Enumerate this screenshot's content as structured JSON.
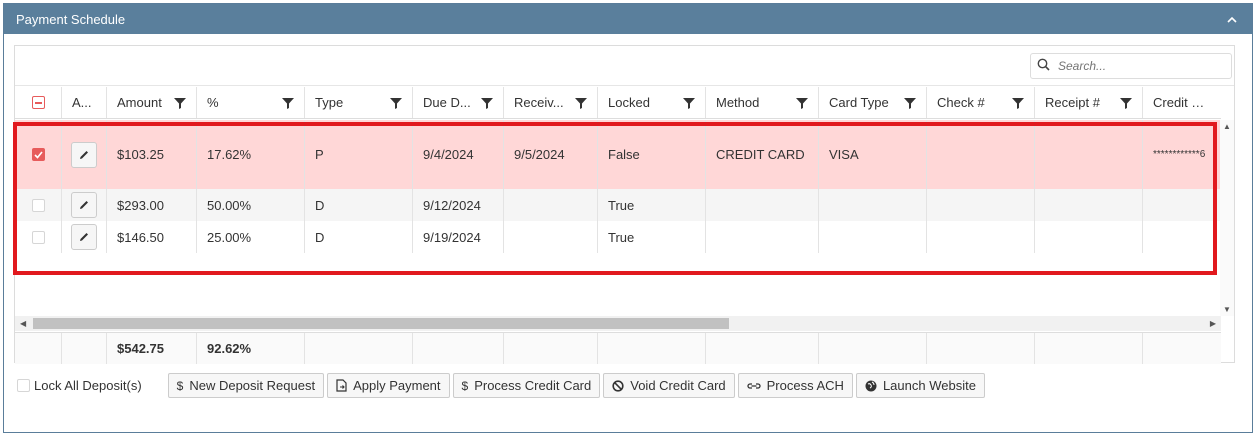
{
  "panel": {
    "title": "Payment Schedule"
  },
  "search": {
    "placeholder": "Search..."
  },
  "columns": [
    {
      "label": "",
      "filter": false
    },
    {
      "label": "A...",
      "filter": false
    },
    {
      "label": "Amount",
      "filter": true
    },
    {
      "label": "%",
      "filter": true
    },
    {
      "label": "Type",
      "filter": true
    },
    {
      "label": "Due D...",
      "filter": true
    },
    {
      "label": "Receiv...",
      "filter": true
    },
    {
      "label": "Locked",
      "filter": true
    },
    {
      "label": "Method",
      "filter": true
    },
    {
      "label": "Card Type",
      "filter": true
    },
    {
      "label": "Check #",
      "filter": true
    },
    {
      "label": "Receipt #",
      "filter": true
    },
    {
      "label": "Credit Car...",
      "filter": false
    }
  ],
  "rows": [
    {
      "checked": true,
      "amount": "$103.25",
      "percent": "17.62%",
      "type": "P",
      "due": "9/4/2024",
      "received": "9/5/2024",
      "locked": "False",
      "method": "CREDIT CARD",
      "card_type": "VISA",
      "check": "",
      "receipt": "",
      "credit_card": "************6"
    },
    {
      "checked": false,
      "amount": "$293.00",
      "percent": "50.00%",
      "type": "D",
      "due": "9/12/2024",
      "received": "",
      "locked": "True",
      "method": "",
      "card_type": "",
      "check": "",
      "receipt": "",
      "credit_card": ""
    },
    {
      "checked": false,
      "amount": "$146.50",
      "percent": "25.00%",
      "type": "D",
      "due": "9/19/2024",
      "received": "",
      "locked": "True",
      "method": "",
      "card_type": "",
      "check": "",
      "receipt": "",
      "credit_card": ""
    }
  ],
  "totals": {
    "amount": "$542.75",
    "percent": "92.62%"
  },
  "actions": {
    "lock_label": "Lock All Deposit(s)",
    "new_deposit": "New Deposit Request",
    "apply_payment": "Apply Payment",
    "process_cc": "Process Credit Card",
    "void_cc": "Void Credit Card",
    "process_ach": "Process ACH",
    "launch_website": "Launch Website"
  },
  "colors": {
    "header_bg": "#5a7f9c",
    "selected_row": "#ffd7d7",
    "highlight": "#e1191e",
    "accent": "#e75b5b"
  }
}
